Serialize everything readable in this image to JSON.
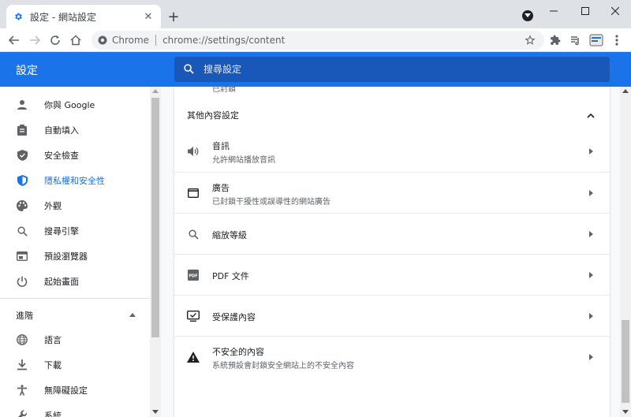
{
  "browser": {
    "tab_title": "設定 - 網站設定",
    "site_chip": "Chrome",
    "url": "chrome://settings/content"
  },
  "header": {
    "title": "設定",
    "search_placeholder": "搜尋設定"
  },
  "sidebar": {
    "items": [
      {
        "label": "你與 Google",
        "icon": "person-icon"
      },
      {
        "label": "自動填入",
        "icon": "clipboard-icon"
      },
      {
        "label": "安全檢查",
        "icon": "shield-check-icon"
      },
      {
        "label": "隱私權和安全性",
        "icon": "shield-icon"
      },
      {
        "label": "外觀",
        "icon": "palette-icon"
      },
      {
        "label": "搜尋引擎",
        "icon": "search-icon"
      },
      {
        "label": "預設瀏覽器",
        "icon": "browser-icon"
      },
      {
        "label": "起始畫面",
        "icon": "power-icon"
      }
    ],
    "advanced_label": "進階",
    "advanced_items": [
      {
        "label": "語言",
        "icon": "globe-icon"
      },
      {
        "label": "下載",
        "icon": "download-icon"
      },
      {
        "label": "無障礙設定",
        "icon": "accessibility-icon"
      },
      {
        "label": "系統",
        "icon": "wrench-icon"
      }
    ],
    "active_color": "#1a73e8"
  },
  "content": {
    "clipped_text": "已封鎖",
    "section_title": "其他內容設定",
    "rows": [
      {
        "title": "音訊",
        "subtitle": "允許網站播放音訊",
        "icon": "speaker-icon"
      },
      {
        "title": "廣告",
        "subtitle": "已封鎖干擾性或誤導性的網站廣告",
        "icon": "ads-window-icon"
      },
      {
        "title": "縮放等級",
        "subtitle": "",
        "icon": "zoom-icon"
      },
      {
        "title": "PDF 文件",
        "subtitle": "",
        "icon": "pdf-icon"
      },
      {
        "title": "受保護內容",
        "subtitle": "",
        "icon": "protected-monitor-icon"
      },
      {
        "title": "不安全的內容",
        "subtitle": "系統預設會封鎖安全網站上的不安全內容",
        "icon": "warning-icon"
      }
    ]
  },
  "colors": {
    "header_blue": "#1a73e8",
    "search_bg": "#1958b8"
  }
}
